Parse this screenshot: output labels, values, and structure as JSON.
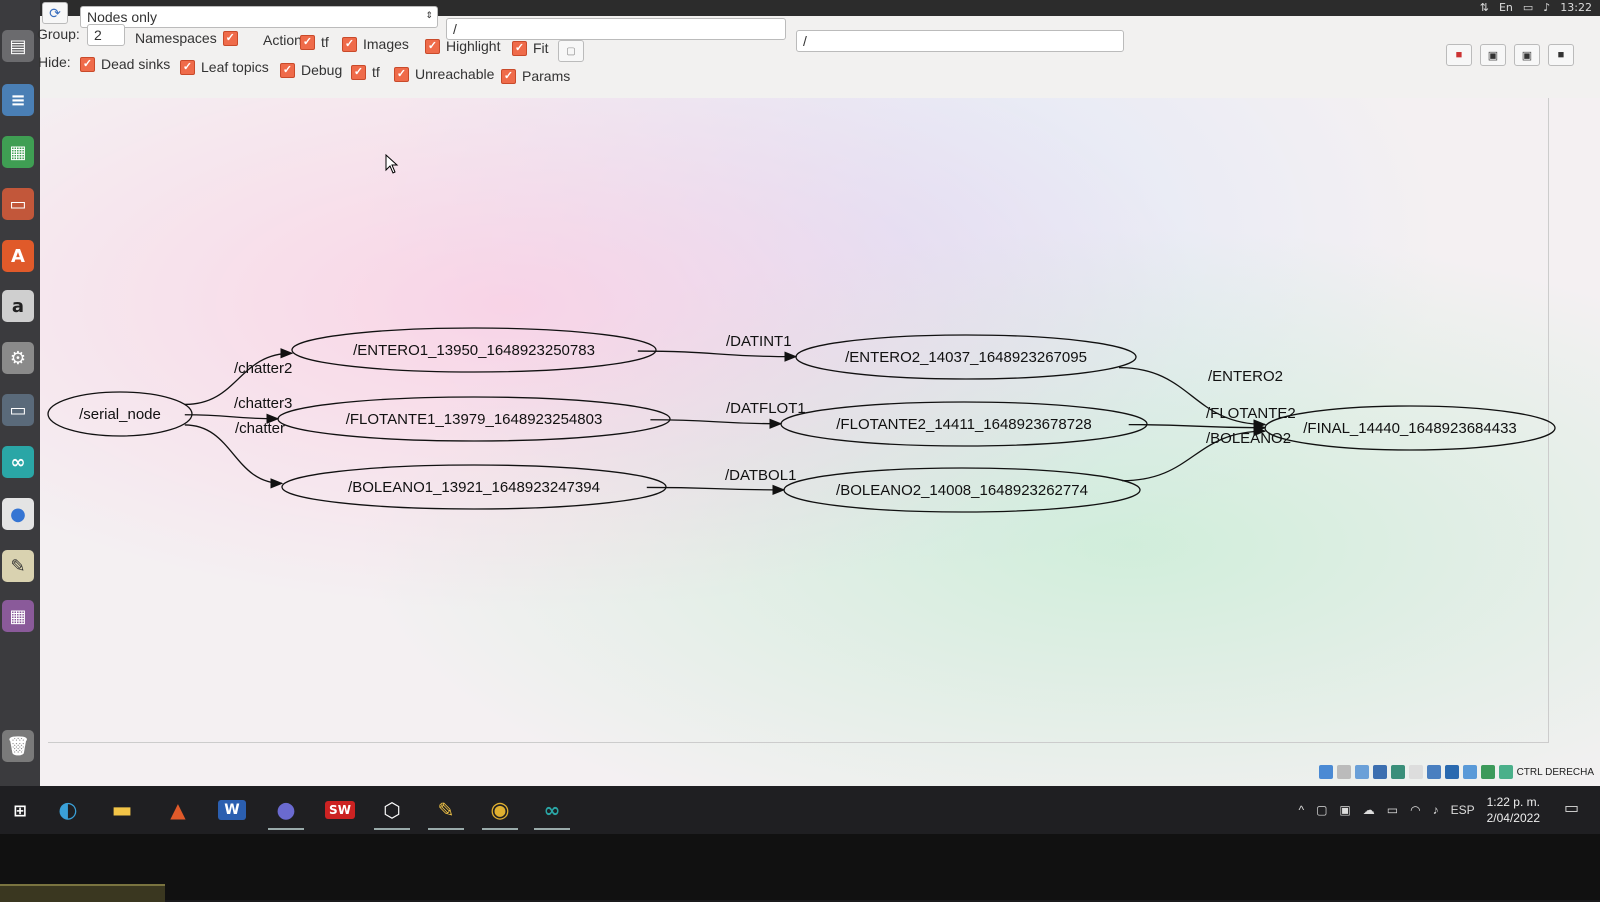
{
  "toolbar": {
    "view_mode": "Nodes only",
    "filter1": "/",
    "filter2": "/",
    "group_label": "Group:",
    "group_value": "2",
    "hide_label": "Hide:",
    "row1_checks": [
      "Namespaces",
      "Actions",
      "tf",
      "Images",
      "Highlight",
      "Fit"
    ],
    "row2_checks": [
      "Dead sinks",
      "Leaf topics",
      "Debug",
      "tf",
      "Unreachable",
      "Params"
    ],
    "checked": [
      true,
      true,
      true,
      true,
      true,
      true
    ]
  },
  "topbar": {
    "keyboard": "En",
    "time": "13:22"
  },
  "graph": {
    "nodes": [
      {
        "id": "serial_node",
        "label": "/serial_node"
      },
      {
        "id": "entero1",
        "label": "/ENTERO1_13950_1648923250783"
      },
      {
        "id": "flotante1",
        "label": "/FLOTANTE1_13979_1648923254803"
      },
      {
        "id": "boleano1",
        "label": "/BOLEANO1_13921_1648923247394"
      },
      {
        "id": "entero2",
        "label": "/ENTERO2_14037_1648923267095"
      },
      {
        "id": "flotante2",
        "label": "/FLOTANTE2_14411_1648923678728"
      },
      {
        "id": "boleano2",
        "label": "/BOLEANO2_14008_1648923262774"
      },
      {
        "id": "final",
        "label": "/FINAL_14440_1648923684433"
      }
    ],
    "edges": [
      {
        "from": "serial_node",
        "to": "entero1",
        "label": "/chatter2"
      },
      {
        "from": "serial_node",
        "to": "flotante1",
        "label": "/chatter3"
      },
      {
        "from": "serial_node",
        "to": "boleano1",
        "label": "/chatter"
      },
      {
        "from": "entero1",
        "to": "entero2",
        "label": "/DATINT1"
      },
      {
        "from": "flotante1",
        "to": "flotante2",
        "label": "/DATFLOT1"
      },
      {
        "from": "boleano1",
        "to": "boleano2",
        "label": "/DATBOL1"
      },
      {
        "from": "entero2",
        "to": "final",
        "label": "/ENTERO2"
      },
      {
        "from": "flotante2",
        "to": "final",
        "label": "/FLOTANTE2"
      },
      {
        "from": "boleano2",
        "to": "final",
        "label": "/BOLEANO2"
      }
    ]
  },
  "vbox": {
    "host_key": "CTRL DERECHA"
  },
  "taskbar": {
    "apps": [
      "edge-icon",
      "file-explorer-icon",
      "matlab-icon",
      "word-icon",
      "teams-icon",
      "solidworks-icon",
      "3d-box-icon",
      "tools-icon",
      "chrome-icon",
      "arduino-icon"
    ],
    "word_label": "W",
    "solidworks_label": "SW",
    "language": "ESP",
    "time": "1:22 p. m.",
    "date": "2/04/2022"
  }
}
